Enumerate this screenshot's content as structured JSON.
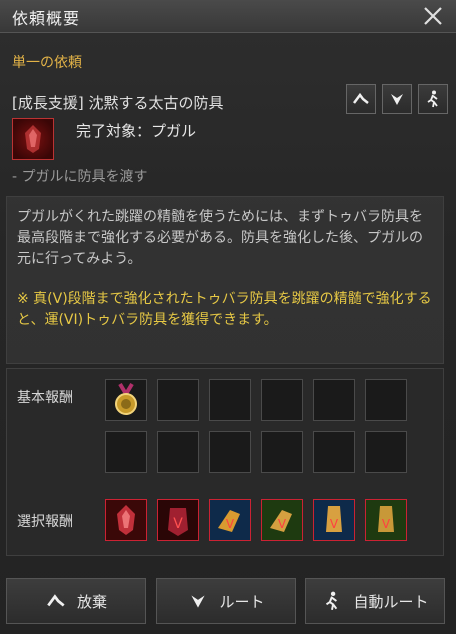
{
  "window": {
    "title": "依頼概要"
  },
  "section": {
    "title": "単一の依頼"
  },
  "quest": {
    "name": "[成長支援] 沈黙する太古の防具",
    "target": "完了対象：プガル",
    "subtask": "- プガルに防具を渡す",
    "description": "プガルがくれた跳躍の精髄を使うためには、まずトゥバラ防具を最高段階まで強化する必要がある。防具を強化した後、プガルの元に行ってみよう。",
    "note": "※ 真(V)段階まで強化されたトゥバラ防具を跳躍の精髄で強化すると、運(VI)トゥバラ防具を獲得できます。"
  },
  "rewards": {
    "basic_label": "基本報酬",
    "choice_label": "選択報酬"
  },
  "buttons": {
    "abandon": "放棄",
    "route": "ルート",
    "auto_route": "自動ルート"
  },
  "colors": {
    "accent": "#e3b347",
    "note": "#e6c845"
  }
}
